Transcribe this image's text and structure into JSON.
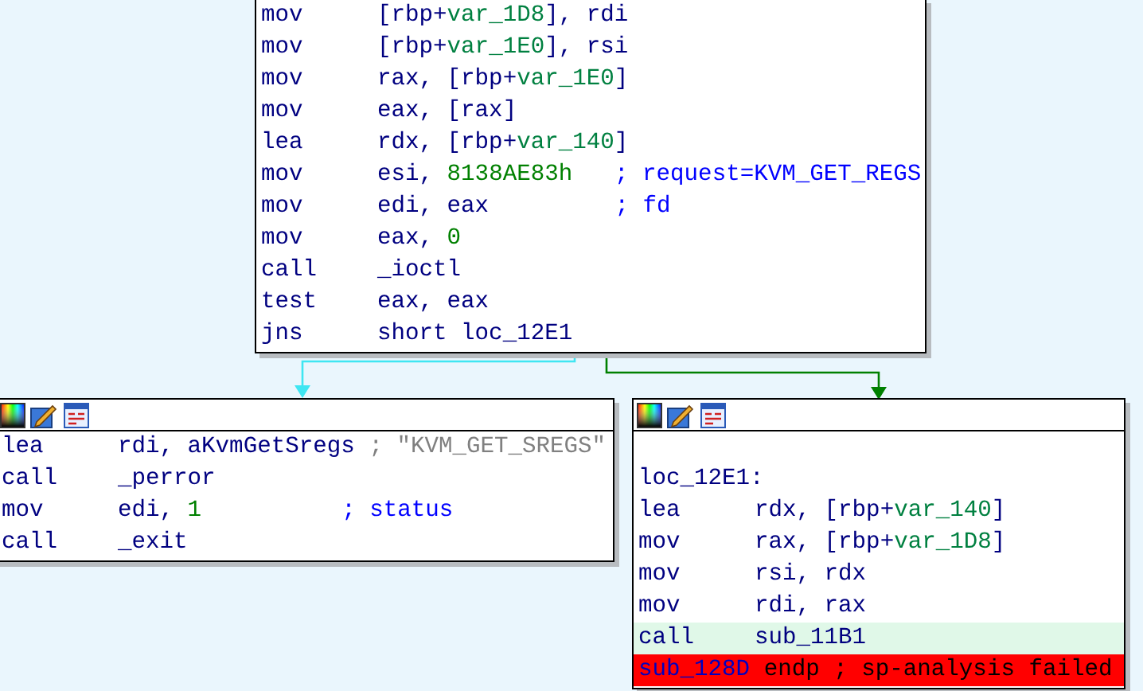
{
  "blocks": [
    {
      "toolbar": false,
      "lines": [
        {
          "kind": "instr",
          "highlighted": false,
          "mnemonic": "mov",
          "operands": [
            {
              "text": "[rbp+",
              "kind": "reg"
            },
            {
              "text": "var_1D8",
              "kind": "var"
            },
            {
              "text": "], rdi",
              "kind": "reg"
            }
          ]
        },
        {
          "kind": "instr",
          "highlighted": false,
          "mnemonic": "mov",
          "operands": [
            {
              "text": "[rbp+",
              "kind": "reg"
            },
            {
              "text": "var_1E0",
              "kind": "var"
            },
            {
              "text": "], rsi",
              "kind": "reg"
            }
          ]
        },
        {
          "kind": "instr",
          "highlighted": false,
          "mnemonic": "mov",
          "operands": [
            {
              "text": "rax, [rbp+",
              "kind": "reg"
            },
            {
              "text": "var_1E0",
              "kind": "var"
            },
            {
              "text": "]",
              "kind": "reg"
            }
          ]
        },
        {
          "kind": "instr",
          "highlighted": false,
          "mnemonic": "mov",
          "operands": [
            {
              "text": "eax, [rax]",
              "kind": "reg"
            }
          ]
        },
        {
          "kind": "instr",
          "highlighted": false,
          "mnemonic": "lea",
          "operands": [
            {
              "text": "rdx, [rbp+",
              "kind": "reg"
            },
            {
              "text": "var_140",
              "kind": "var"
            },
            {
              "text": "]",
              "kind": "reg"
            }
          ]
        },
        {
          "kind": "instr",
          "highlighted": false,
          "mnemonic": "mov",
          "operands": [
            {
              "text": "esi, ",
              "kind": "reg"
            },
            {
              "text": "8138AE83h",
              "kind": "num"
            }
          ],
          "comment": {
            "text": "; request=KVM_GET_REGS",
            "kind": "auto"
          }
        },
        {
          "kind": "instr",
          "highlighted": false,
          "mnemonic": "mov",
          "operands": [
            {
              "text": "edi, eax",
              "kind": "reg"
            }
          ],
          "comment": {
            "text": "; fd",
            "kind": "auto"
          }
        },
        {
          "kind": "instr",
          "highlighted": false,
          "mnemonic": "mov",
          "operands": [
            {
              "text": "eax, ",
              "kind": "reg"
            },
            {
              "text": "0",
              "kind": "num"
            }
          ]
        },
        {
          "kind": "instr",
          "highlighted": false,
          "mnemonic": "call",
          "operands": [
            {
              "text": "_ioctl",
              "kind": "name"
            }
          ]
        },
        {
          "kind": "instr",
          "highlighted": false,
          "mnemonic": "test",
          "operands": [
            {
              "text": "eax, eax",
              "kind": "reg"
            }
          ]
        },
        {
          "kind": "instr",
          "highlighted": false,
          "mnemonic": "jns",
          "operands": [
            {
              "text": "short loc_12E1",
              "kind": "reg"
            }
          ]
        }
      ]
    },
    {
      "toolbar": true,
      "lines": [
        {
          "kind": "instr",
          "highlighted": false,
          "mnemonic": "lea",
          "operands": [
            {
              "text": "rdi, aKvmGetSregs",
              "kind": "reg"
            }
          ],
          "comment": {
            "text": "; \"KVM_GET_SREGS\"",
            "kind": "string"
          }
        },
        {
          "kind": "instr",
          "highlighted": false,
          "mnemonic": "call",
          "operands": [
            {
              "text": "_perror",
              "kind": "name"
            }
          ]
        },
        {
          "kind": "instr",
          "highlighted": false,
          "mnemonic": "mov",
          "operands": [
            {
              "text": "edi, ",
              "kind": "reg"
            },
            {
              "text": "1",
              "kind": "num"
            }
          ],
          "comment": {
            "text": "; status",
            "kind": "auto"
          }
        },
        {
          "kind": "instr",
          "highlighted": false,
          "mnemonic": "call",
          "operands": [
            {
              "text": "_exit",
              "kind": "name"
            }
          ]
        }
      ]
    },
    {
      "toolbar": true,
      "lines": [
        {
          "kind": "label",
          "highlighted": false,
          "text": "loc_12E1:"
        },
        {
          "kind": "instr",
          "highlighted": false,
          "mnemonic": "lea",
          "operands": [
            {
              "text": "rdx, [rbp+",
              "kind": "reg"
            },
            {
              "text": "var_140",
              "kind": "var"
            },
            {
              "text": "]",
              "kind": "reg"
            }
          ]
        },
        {
          "kind": "instr",
          "highlighted": false,
          "mnemonic": "mov",
          "operands": [
            {
              "text": "rax, [rbp+",
              "kind": "reg"
            },
            {
              "text": "var_1D8",
              "kind": "var"
            },
            {
              "text": "]",
              "kind": "reg"
            }
          ]
        },
        {
          "kind": "instr",
          "highlighted": false,
          "mnemonic": "mov",
          "operands": [
            {
              "text": "rsi, rdx",
              "kind": "reg"
            }
          ]
        },
        {
          "kind": "instr",
          "highlighted": false,
          "mnemonic": "mov",
          "operands": [
            {
              "text": "rdi, rax",
              "kind": "reg"
            }
          ]
        },
        {
          "kind": "instr",
          "highlighted": true,
          "mnemonic": "call",
          "operands": [
            {
              "text": "sub_11B1",
              "kind": "reg"
            }
          ]
        },
        {
          "kind": "error",
          "segments": [
            {
              "text": "sub_128D",
              "kind": "name"
            },
            {
              "text": "endp ; sp-analysis failed",
              "kind": "plain"
            }
          ]
        }
      ]
    }
  ],
  "edges": [
    {
      "color": "#3fe6f2"
    },
    {
      "color": "#008000"
    }
  ]
}
